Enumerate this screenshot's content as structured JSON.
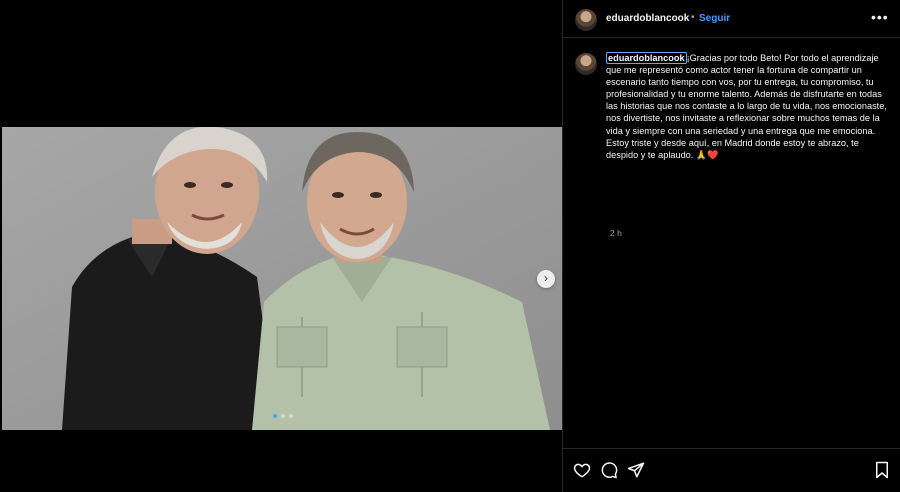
{
  "post": {
    "username": "eduardoblancook",
    "separator": "•",
    "follow_label": "Seguir",
    "more_label": "•••",
    "caption_user": "eduardoblancook",
    "caption_text": "¡Gracias por todo Beto! Por todo el aprendizaje que me representó como actor tener la fortuna de compartir un escenario tanto tiempo con vos, por tu entrega, tu compromiso, tu profesionalidad y tu enorme talento. Además de disfrutarte en todas las historias que nos contaste a lo largo de tu vida, nos emocionaste, nos divertiste, nos invitaste a reflexionar sobre muchos temas de la vida y siempre con una seriedad y una entrega que me emociona. Estoy triste y desde aquí, en Madrid donde estoy te abrazo, te despido y te aplaudo. 🙏❤️",
    "timestamp": "2 h"
  },
  "carousel": {
    "next_icon": "chevron-right-icon",
    "dot_count": 3,
    "active_index": 0
  },
  "icons": {
    "like": "heart-icon",
    "comment": "comment-icon",
    "share": "share-icon",
    "save": "bookmark-icon"
  },
  "colors": {
    "link": "#4a9bff",
    "background": "#000000",
    "muted": "#a8a8a8"
  }
}
